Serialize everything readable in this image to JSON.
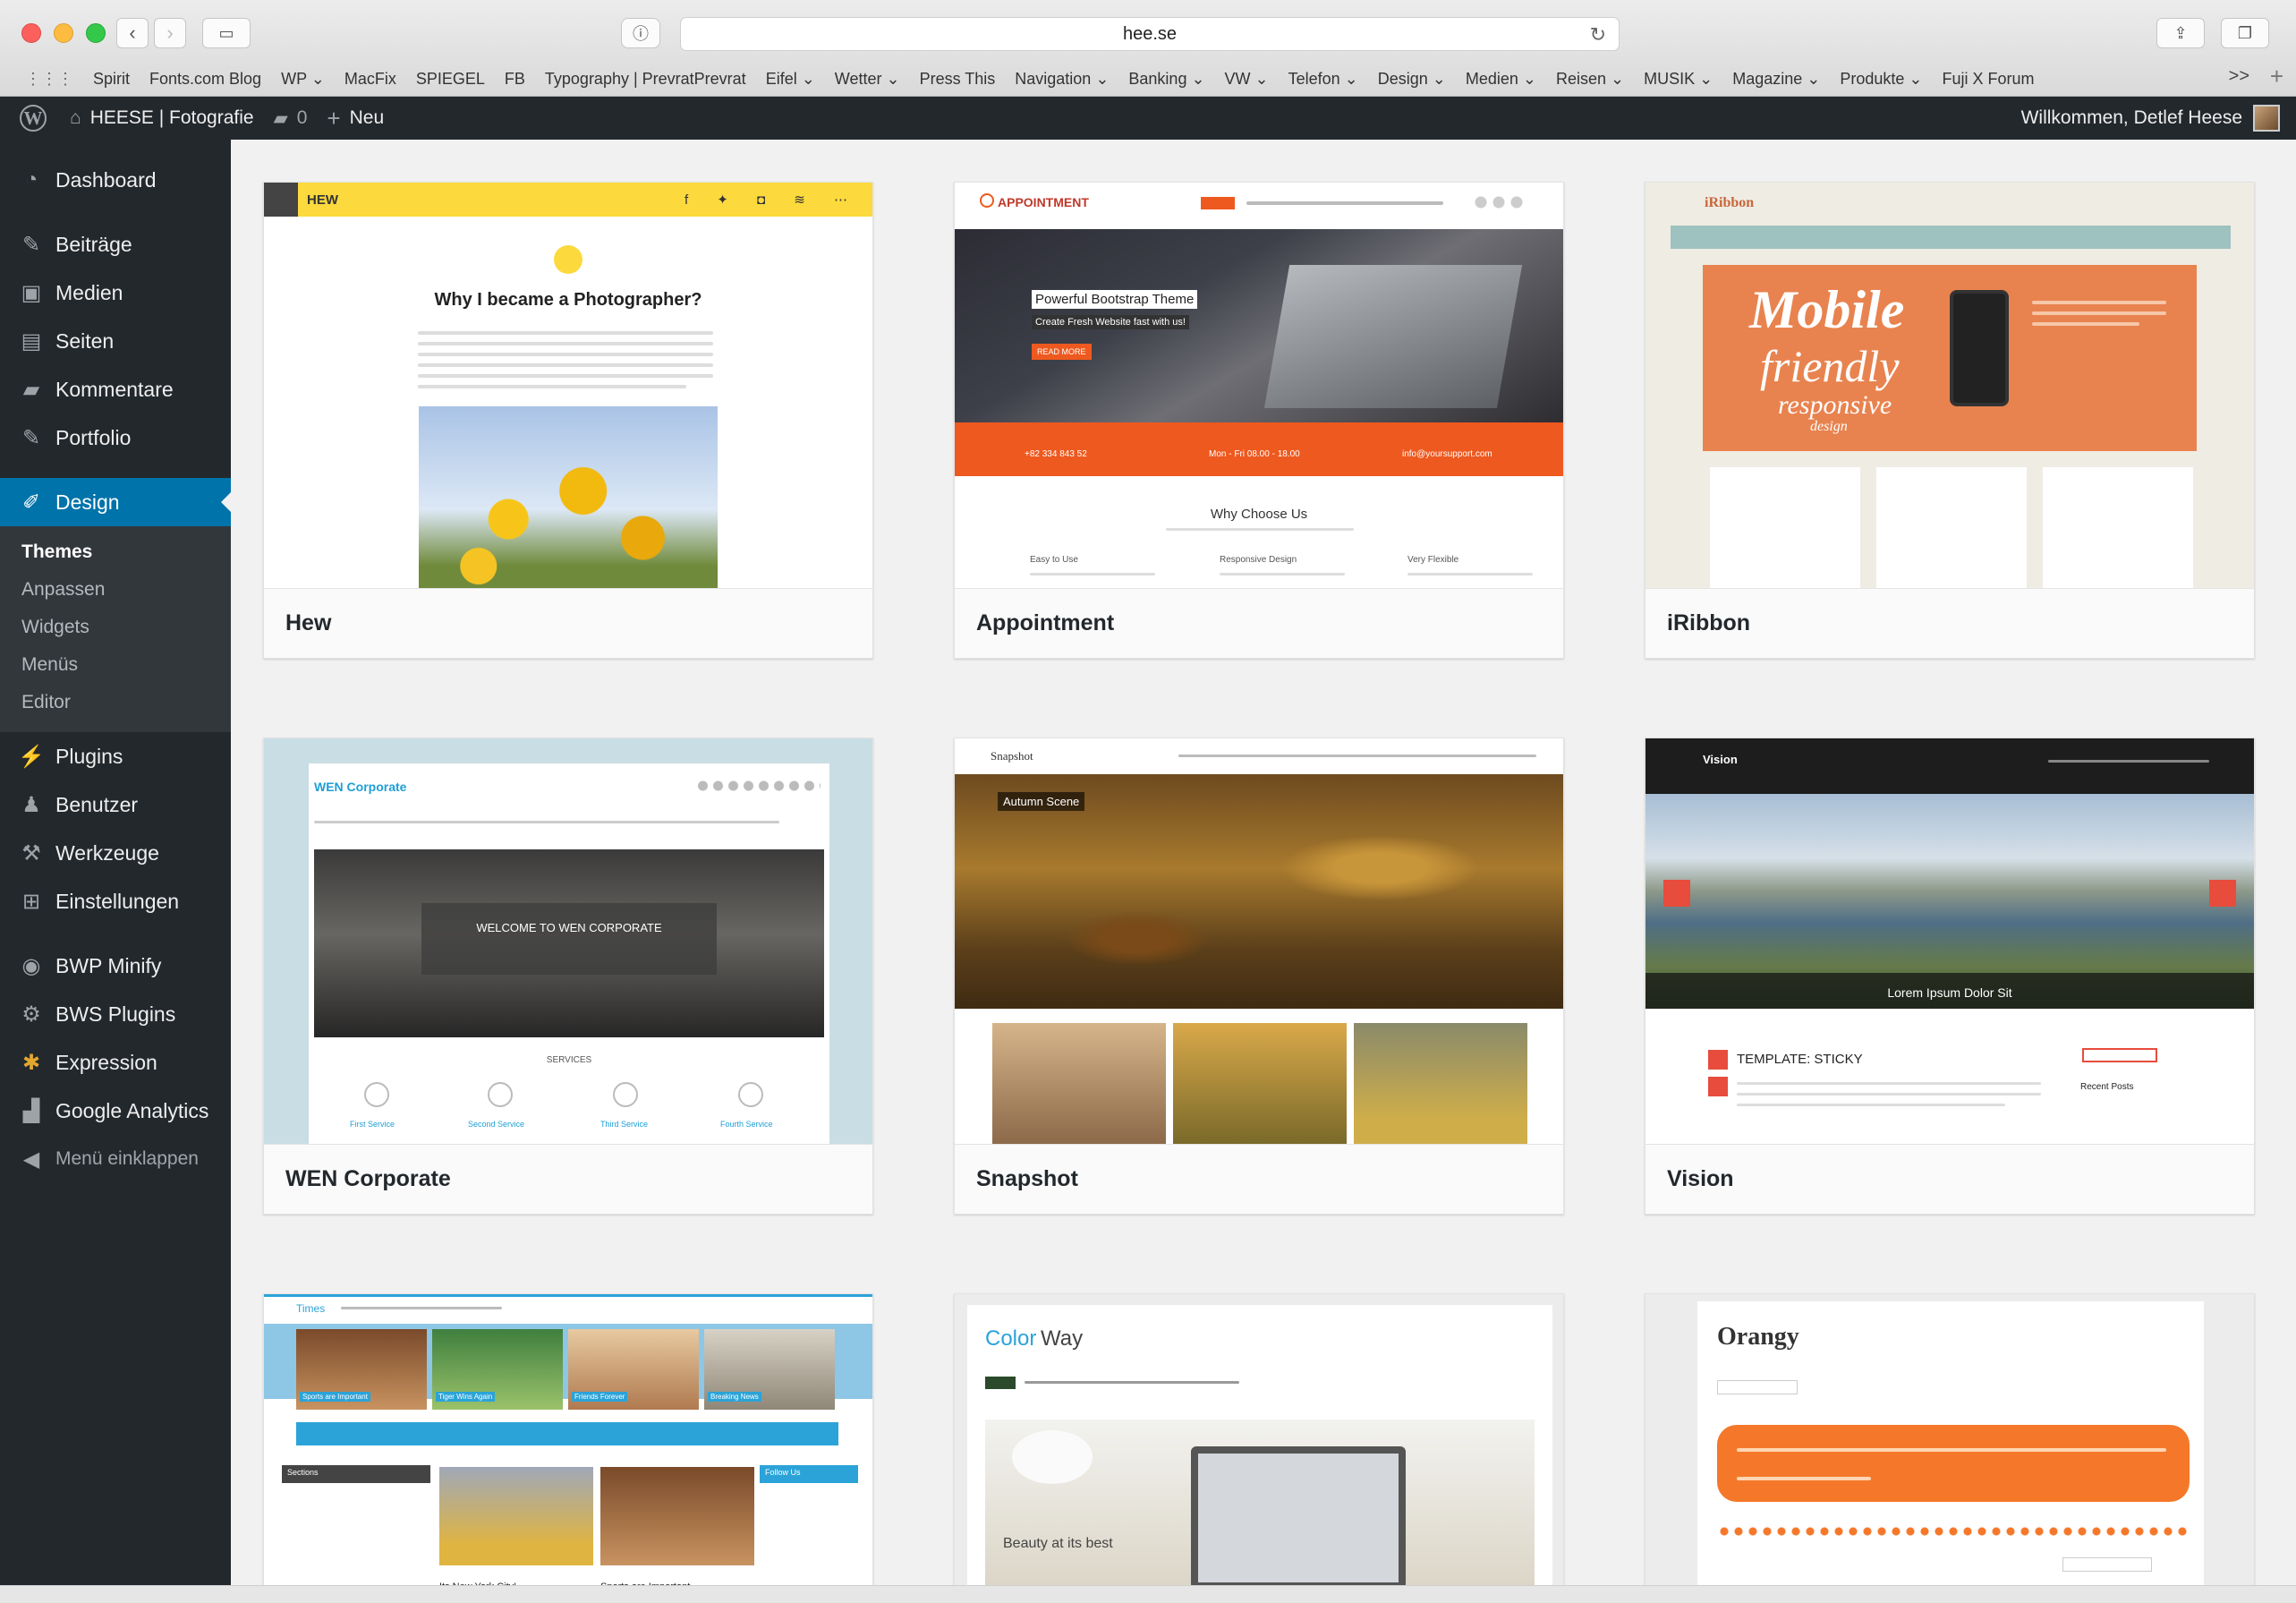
{
  "browser": {
    "url": "hee.se",
    "bookmarks": [
      "Spirit",
      "Fonts.com Blog",
      "WP ⌄",
      "MacFix",
      "SPIEGEL",
      "FB",
      "Typography | PrevratPrevrat",
      "Eifel ⌄",
      "Wetter ⌄",
      "Press This",
      "Navigation ⌄",
      "Banking ⌄",
      "VW ⌄",
      "Telefon ⌄",
      "Design ⌄",
      "Medien ⌄",
      "Reisen ⌄",
      "MUSIK ⌄",
      "Magazine ⌄",
      "Produkte ⌄",
      "Fuji X Forum"
    ],
    "more": ">>"
  },
  "adminbar": {
    "site_name": "HEESE | Fotografie",
    "comments_count": "0",
    "new_label": "Neu",
    "welcome": "Willkommen, Detlef Heese"
  },
  "sidebar": {
    "dashboard": "Dashboard",
    "beitraege": "Beiträge",
    "medien": "Medien",
    "seiten": "Seiten",
    "kommentare": "Kommentare",
    "portfolio": "Portfolio",
    "design": "Design",
    "submenu": [
      "Themes",
      "Anpassen",
      "Widgets",
      "Menüs",
      "Editor"
    ],
    "plugins": "Plugins",
    "benutzer": "Benutzer",
    "werkzeuge": "Werkzeuge",
    "einstellungen": "Einstellungen",
    "bwp_minify": "BWP Minify",
    "bws_plugins": "BWS Plugins",
    "expression": "Expression",
    "google_analytics": "Google Analytics",
    "collapse": "Menü einklappen"
  },
  "themes": [
    {
      "name": "Hew",
      "preview": {
        "brand": "HEW",
        "headline": "Why I became a Photographer?"
      }
    },
    {
      "name": "Appointment",
      "preview": {
        "brand": "APPOINTMENT",
        "hero": "Powerful Bootstrap Theme",
        "sub": "Create Fresh Website fast with us!",
        "button": "READ MORE",
        "section": "Why Choose Us",
        "features": [
          "Easy to Use",
          "Responsive Design",
          "Very Flexible"
        ],
        "contact": [
          "+82 334 843 52",
          "Mon - Fri 08.00 - 18.00",
          "info@yoursupport.com"
        ]
      }
    },
    {
      "name": "iRibbon",
      "preview": {
        "brand": "iRibbon",
        "banner_1": "Mobile",
        "banner_2": "friendly",
        "banner_3": "responsive",
        "banner_4": "design"
      }
    },
    {
      "name": "WEN Corporate",
      "preview": {
        "brand": "WEN Corporate",
        "hero": "WELCOME TO WEN CORPORATE",
        "section": "SERVICES",
        "services": [
          "First Service",
          "Second Service",
          "Third Service",
          "Fourth Service"
        ]
      }
    },
    {
      "name": "Snapshot",
      "preview": {
        "brand": "Snapshot",
        "caption": "Autumn Scene"
      }
    },
    {
      "name": "Vision",
      "preview": {
        "brand": "Vision",
        "caption": "Lorem Ipsum Dolor Sit",
        "post": "TEMPLATE: STICKY",
        "recent": "Recent Posts"
      }
    },
    {
      "name": "",
      "preview": {
        "brand": "Times",
        "captions": [
          "Sports are Important",
          "Tiger Wins Again",
          "Friends Forever",
          "Breaking News"
        ],
        "sections": "Sections",
        "follow": "Follow Us",
        "post_1": "Its New York City!",
        "post_2": "Sports are Important"
      }
    },
    {
      "name": "",
      "preview": {
        "brand_1": "Color",
        "brand_2": "Way",
        "caption": "Beauty at its best"
      }
    },
    {
      "name": "",
      "preview": {
        "brand": "Orangy"
      }
    }
  ],
  "colors": {
    "admin_dark": "#23282d",
    "admin_blue": "#0073aa",
    "hew_yellow": "#fcd93d",
    "appointment_orange": "#ee591f",
    "iribbon_orange": "#e8834f",
    "orangy": "#f5782a"
  }
}
